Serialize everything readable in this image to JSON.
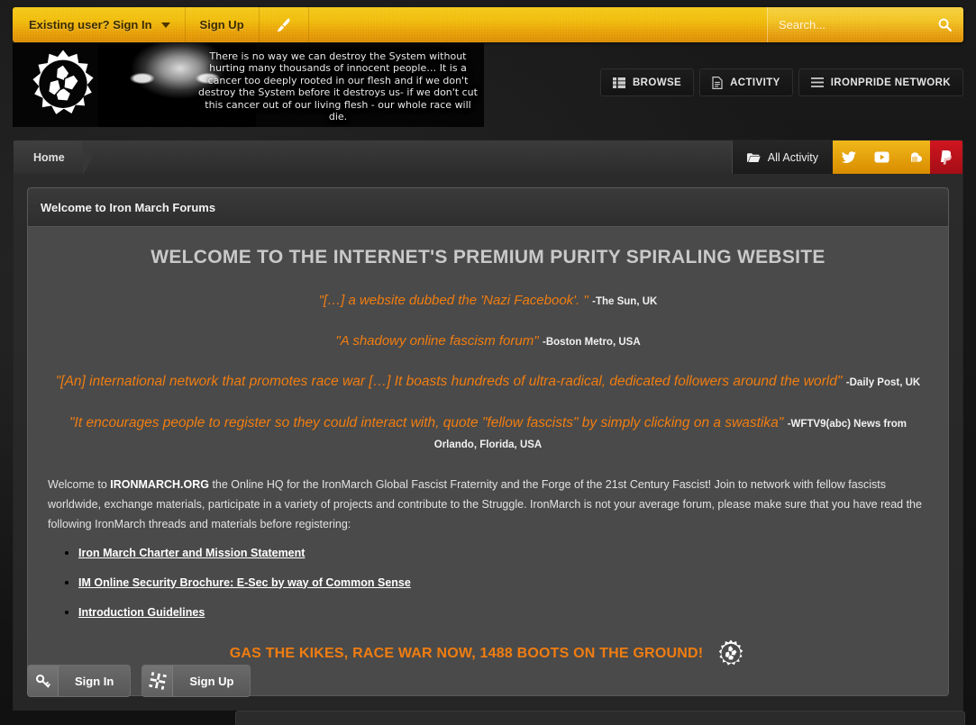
{
  "topbar": {
    "signin_label": "Existing user? Sign In",
    "signup_label": "Sign Up",
    "theme_icon": "paintbrush-icon",
    "search_placeholder": "Search...",
    "search_value": "",
    "search_icon": "search-icon",
    "colors": {
      "top": "#f3c81a",
      "bottom": "#dd8c00"
    }
  },
  "banner": {
    "logo_icon": "ironmarch-gear-logo",
    "quote": "There is no way we can destroy the System without hurting many thousands of innocent people… It is a cancer too deeply rooted in our flesh and if we don't destroy the System before it destroys us- if we don't cut this cancer out of our living flesh - our whole race will die."
  },
  "mainnav": {
    "items": [
      {
        "label": "BROWSE",
        "icon": "list-grid-icon"
      },
      {
        "label": "ACTIVITY",
        "icon": "document-icon"
      },
      {
        "label": "IRONPRIDE NETWORK",
        "icon": "hamburger-menu-icon"
      }
    ]
  },
  "crumbbar": {
    "breadcrumb": "Home",
    "all_activity_label": "All Activity",
    "all_activity_icon": "folder-open-icon",
    "social": [
      {
        "name": "twitter",
        "icon": "twitter-bird-icon",
        "color": "#e0a008"
      },
      {
        "name": "youtube",
        "icon": "youtube-play-icon",
        "color": "#e0a008"
      },
      {
        "name": "soundcloud",
        "icon": "soundcloud-cloud-icon",
        "color": "#e0a008"
      },
      {
        "name": "paypal",
        "icon": "paypal-icon",
        "color": "#c4121a"
      }
    ]
  },
  "card": {
    "title": "Welcome to Iron March Forums",
    "hero": "WELCOME TO THE INTERNET'S PREMIUM PURITY SPIRALING WEBSITE",
    "quotes": [
      {
        "text": "\"[…] a website dubbed the 'Nazi Facebook'. \"",
        "attribution": "-The Sun, UK"
      },
      {
        "text": "\"A shadowy online fascism forum\"",
        "attribution": "-Boston Metro, USA"
      },
      {
        "text": "\"[An] international network that promotes race war […] It boasts hundreds of ultra-radical, dedicated followers around the world\"",
        "attribution": "-Daily Post, UK"
      },
      {
        "text": "\"It encourages people to register so they could interact with, quote \"fellow fascists\" by simply clicking on a swastika\"",
        "attribution": "-WFTV9(abc) News from Orlando, Florida, USA"
      }
    ],
    "paragraph_pre": "Welcome to ",
    "paragraph_brand": "IRONMARCH.ORG",
    "paragraph_post": " the Online HQ for the IronMarch Global Fascist Fraternity and the Forge of the 21st Century Fascist! Join to network with fellow fascists worldwide, exchange materials, participate in a variety of projects and contribute to the Struggle. IronMarch is not your average forum, please make sure that you have read the following IronMarch threads and materials before registering:",
    "links": [
      "Iron March Charter and Mission Statement",
      "IM Online Security Brochure: E-Sec by way of Common Sense",
      "Introduction Guidelines"
    ],
    "slogan": "GAS THE KIKES, RACE WAR NOW, 1488 BOOTS ON THE GROUND!",
    "slogan_icon": "ironmarch-gear-logo",
    "slogan_color": "#f07d10"
  },
  "footer": {
    "signin_label": "Sign In",
    "signin_icon": "key-icon",
    "signup_label": "Sign Up",
    "signup_icon": "swastika-icon"
  }
}
